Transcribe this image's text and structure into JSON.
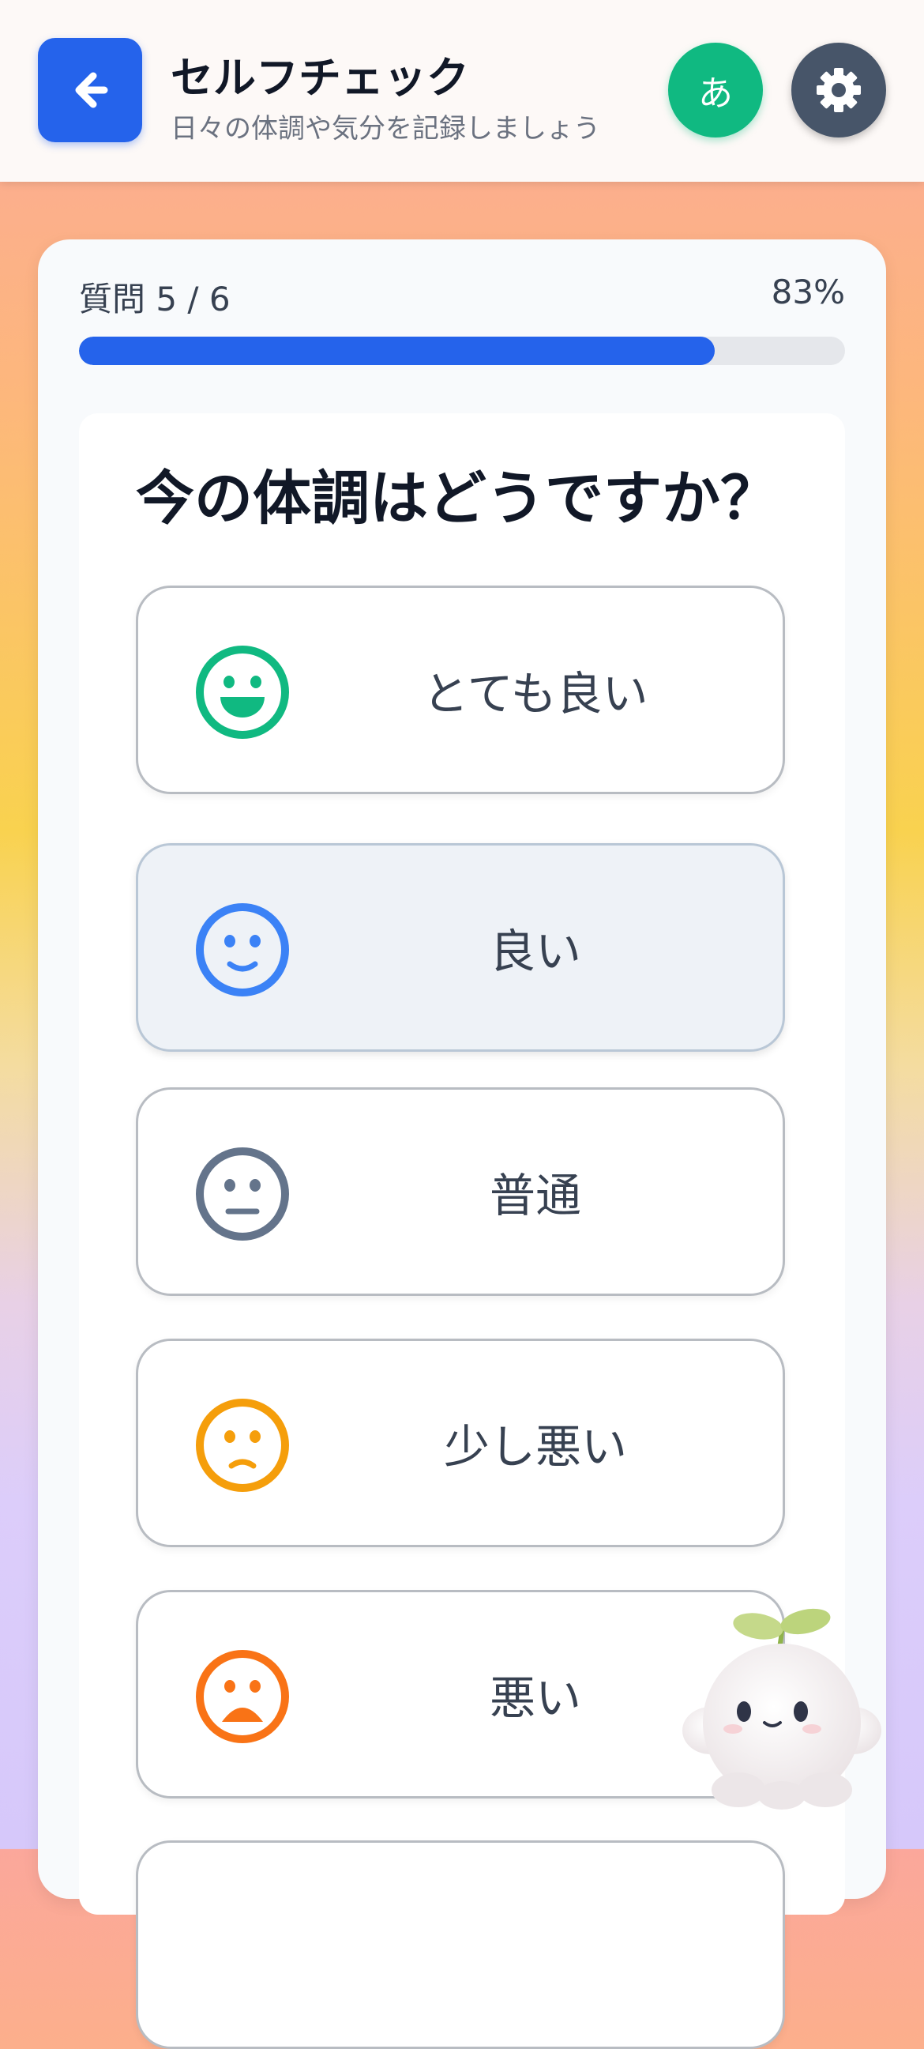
{
  "header": {
    "title": "セルフチェック",
    "subtitle": "日々の体調や気分を記録しましょう",
    "lang_label": "あ",
    "back_icon": "arrow-left-icon",
    "settings_icon": "gear-icon"
  },
  "progress": {
    "label": "質問 5 / 6",
    "percent_text": "83%",
    "percent": 83,
    "fill_color": "#2563eb"
  },
  "question": {
    "text": "今の体調はどうですか？",
    "options": [
      {
        "label": "とても良い",
        "icon": "very-happy-face-icon",
        "color": "#10b981",
        "selected": false
      },
      {
        "label": "良い",
        "icon": "smile-face-icon",
        "color": "#3b82f6",
        "selected": true
      },
      {
        "label": "普通",
        "icon": "neutral-face-icon",
        "color": "#64748b",
        "selected": false
      },
      {
        "label": "少し悪い",
        "icon": "slightly-sad-face-icon",
        "color": "#f59e0b",
        "selected": false
      },
      {
        "label": "悪い",
        "icon": "sad-face-icon",
        "color": "#f97316",
        "selected": false
      }
    ]
  },
  "colors": {
    "accent": "#2563eb",
    "lang_button": "#10b981",
    "settings_button": "#475569"
  }
}
